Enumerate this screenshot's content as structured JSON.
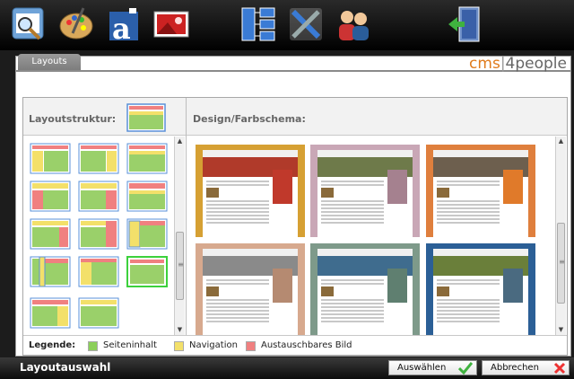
{
  "toolbar": {
    "icons": [
      "search-page-icon",
      "palette-icon",
      "font-icon",
      "image-icon",
      "sitemap-icon",
      "tools-icon",
      "users-icon",
      "exit-door-icon"
    ]
  },
  "panel": {
    "tab_label": "Layouts",
    "brand": {
      "part1": "cms",
      "separator": "|",
      "part2": "4people"
    }
  },
  "header": {
    "layout_structure_label": "Layoutstruktur:",
    "design_label": "Design/Farbschema:"
  },
  "designs": [
    {
      "frame": "#d6a033",
      "hero": "#b03a2a",
      "side": "#c0392b"
    },
    {
      "frame": "#c9a7b6",
      "hero": "#6e7a4a",
      "side": "#a5818f"
    },
    {
      "frame": "#df7f3d",
      "hero": "#6d5f4e",
      "side": "#e07a2a"
    },
    {
      "frame": "#d7a98e",
      "hero": "#8a8a8a",
      "side": "#b58a71"
    },
    {
      "frame": "#7e9a8a",
      "hero": "#3f6c8e",
      "side": "#5f7f70"
    },
    {
      "frame": "#2b5f96",
      "hero": "#6a7f3a",
      "side": "#4a6a80"
    }
  ],
  "legend": {
    "title": "Legende:",
    "items": [
      {
        "label": "Seiteninhalt",
        "color": "#8ccf5a"
      },
      {
        "label": "Navigation",
        "color": "#f3e06a"
      },
      {
        "label": "Austauschbares Bild",
        "color": "#f08080"
      }
    ]
  },
  "bottom": {
    "title": "Layoutauswahl",
    "select_label": "Auswählen",
    "cancel_label": "Abbrechen"
  }
}
